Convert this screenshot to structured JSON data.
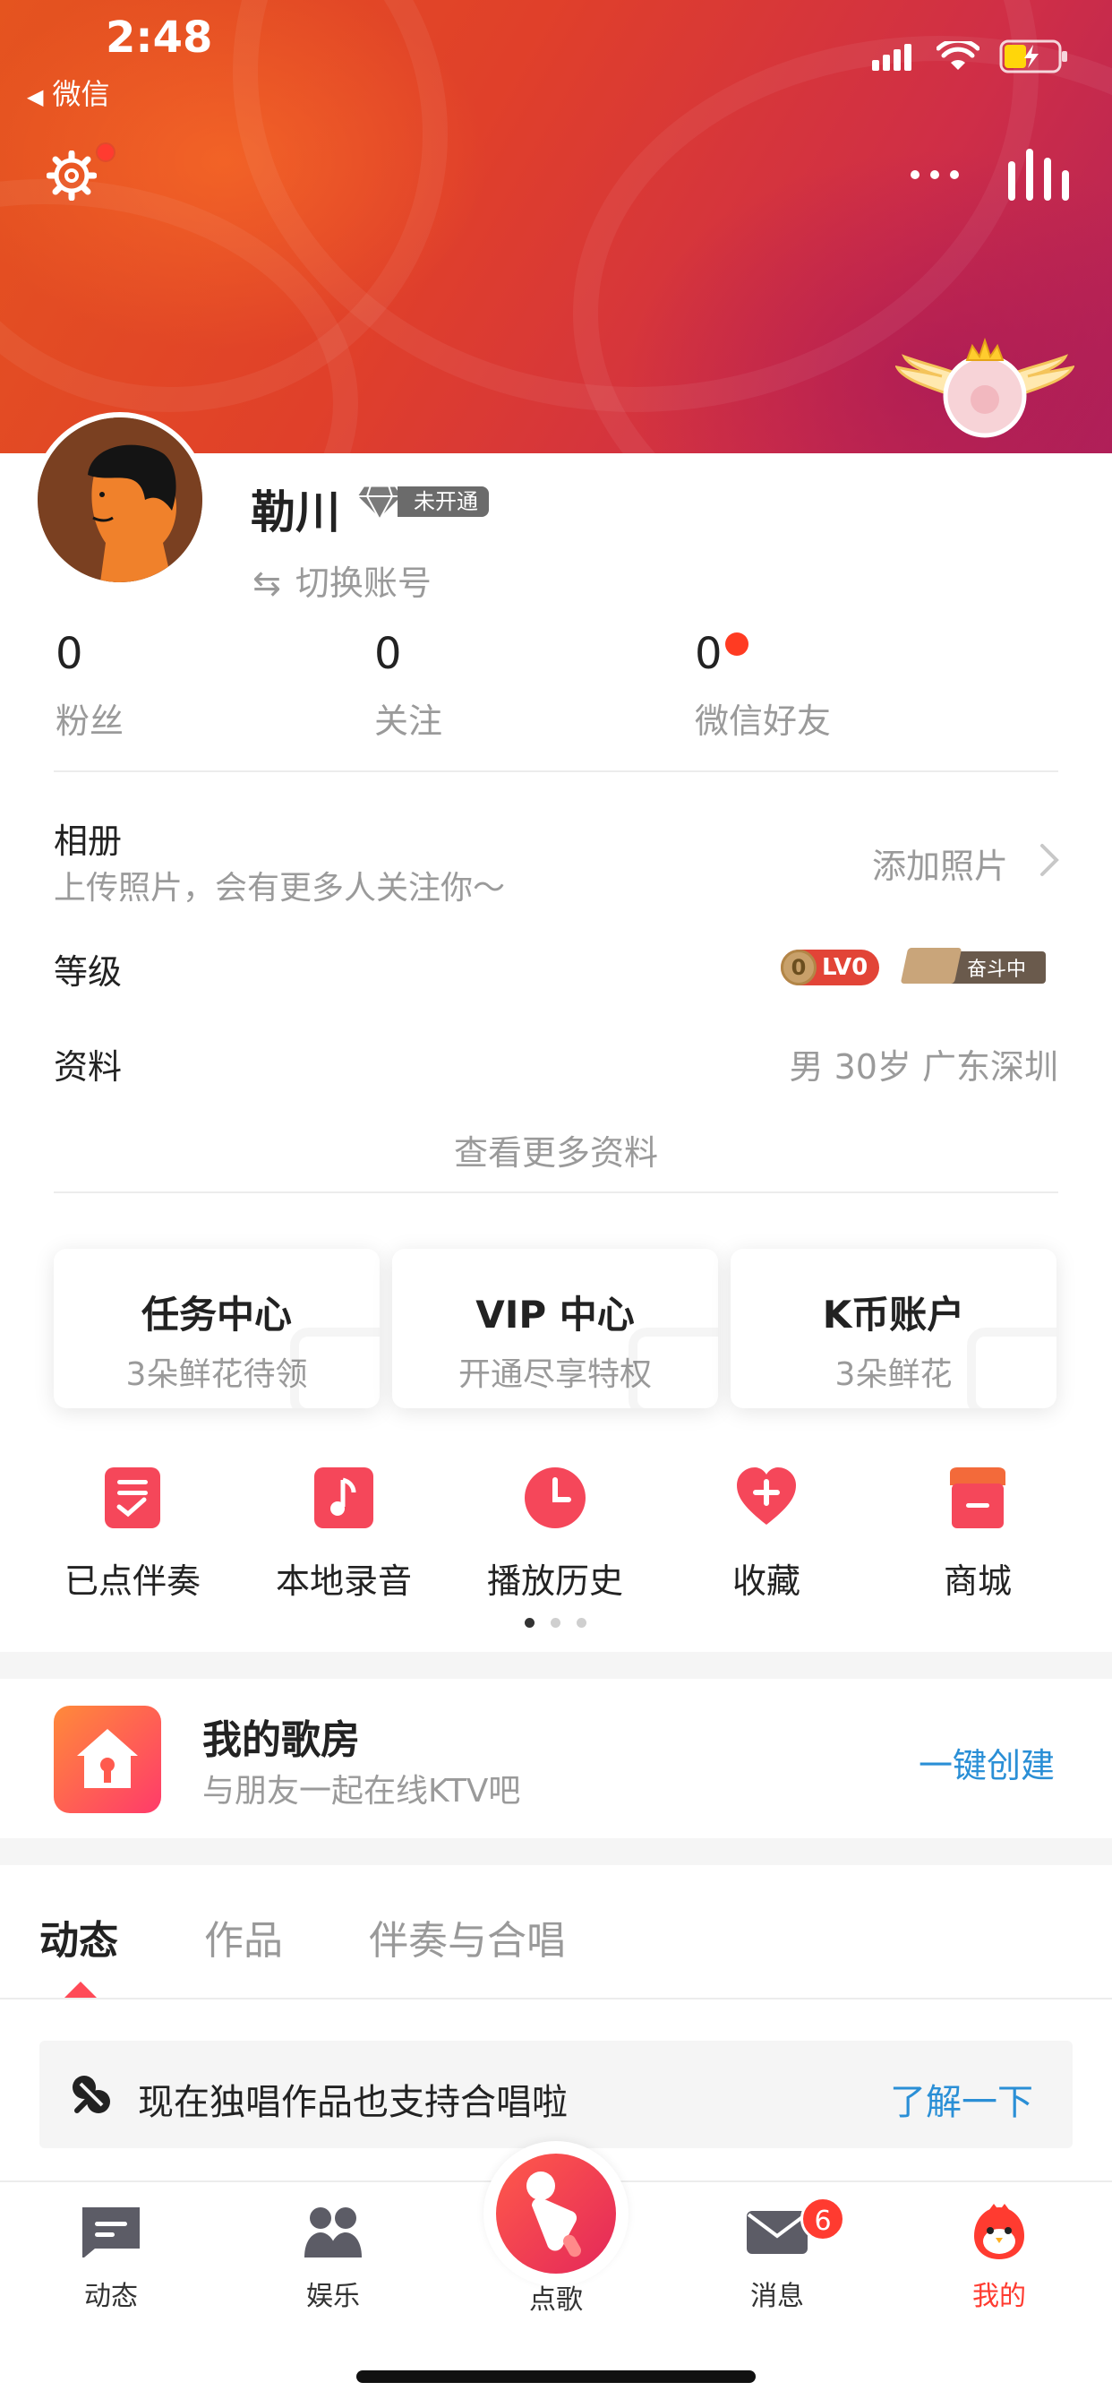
{
  "status_bar": {
    "time": "2:48",
    "back_app": "微信"
  },
  "profile": {
    "name": "勒川",
    "vip_status": "未开通",
    "switch_account": "切换账号"
  },
  "stats": [
    {
      "value": "0",
      "label": "粉丝"
    },
    {
      "value": "0",
      "label": "关注"
    },
    {
      "value": "0",
      "label": "微信好友"
    }
  ],
  "album": {
    "label": "相册",
    "subtitle": "上传照片，会有更多人关注你～",
    "action": "添加照片"
  },
  "level": {
    "label": "等级",
    "coin": "0",
    "lv": "LV0",
    "status": "奋斗中"
  },
  "info": {
    "label": "资料",
    "value": "男 30岁 广东深圳",
    "more": "查看更多资料"
  },
  "cards": [
    {
      "title": "任务中心",
      "subtitle": "3朵鲜花待领"
    },
    {
      "title": "VIP 中心",
      "subtitle": "开通尽享特权"
    },
    {
      "title": "K币账户",
      "subtitle": "3朵鲜花"
    }
  ],
  "quick_actions": [
    {
      "label": "已点伴奏",
      "icon": "checklist-icon"
    },
    {
      "label": "本地录音",
      "icon": "music-note-icon"
    },
    {
      "label": "播放历史",
      "icon": "clock-icon"
    },
    {
      "label": "收藏",
      "icon": "heart-plus-icon"
    },
    {
      "label": "商城",
      "icon": "shop-icon"
    }
  ],
  "room": {
    "title": "我的歌房",
    "subtitle": "与朋友一起在线KTV吧",
    "action": "一键创建"
  },
  "tabs": [
    "动态",
    "作品",
    "伴奏与合唱"
  ],
  "tip": {
    "text": "现在独唱作品也支持合唱啦",
    "link": "了解一下"
  },
  "nav": [
    {
      "label": "动态",
      "icon": "feed-icon"
    },
    {
      "label": "娱乐",
      "icon": "people-icon"
    },
    {
      "label": "点歌",
      "icon": "sing-icon"
    },
    {
      "label": "消息",
      "icon": "mail-icon",
      "badge": "6"
    },
    {
      "label": "我的",
      "icon": "bird-icon"
    }
  ],
  "colors": {
    "accent": "#ff3b30",
    "link": "#2a8fd6",
    "banner": "#e0402a"
  }
}
